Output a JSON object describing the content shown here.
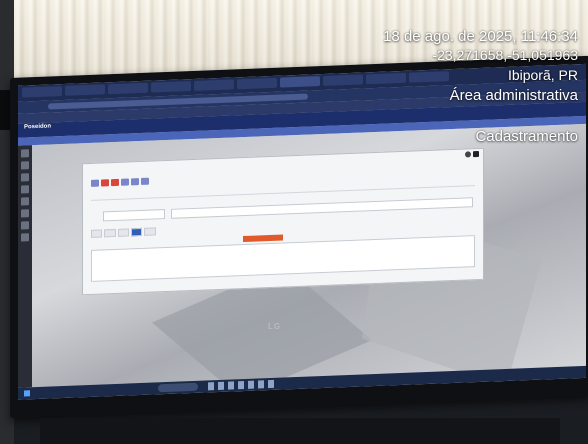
{
  "overlay": {
    "datetime": "18 de ago. de 2025, 11:46:34",
    "coordinates": "-23,271658,-51,051963",
    "city": "Ibiporã, PR",
    "area": "Área administrativa",
    "section": "Cadastramento"
  },
  "app": {
    "logo": "Poseidon",
    "brand_monitor": "LG"
  },
  "colors": {
    "header": "#1c2e6b",
    "subheader": "#4b66b8",
    "red_button": "#e05a2b"
  }
}
